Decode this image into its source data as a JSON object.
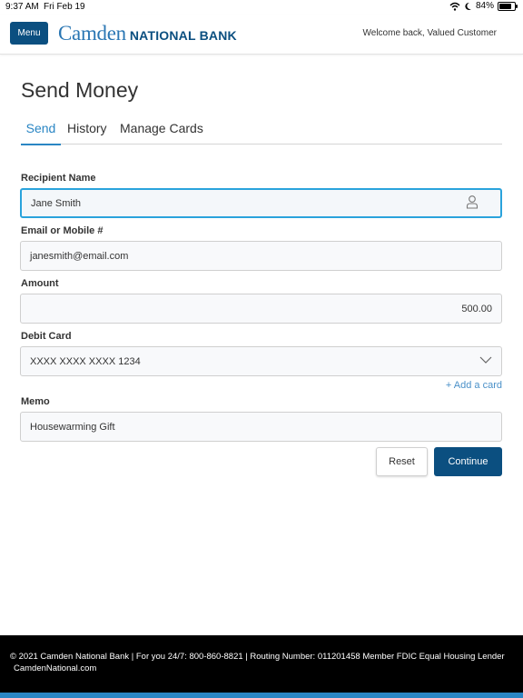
{
  "status_bar": {
    "time": "9:37 AM",
    "date": "Fri Feb 19",
    "battery": "84%",
    "battery_level": 0.84
  },
  "header": {
    "menu_label": "Menu",
    "logo_primary": "Camden",
    "logo_secondary": "NATIONAL BANK",
    "welcome": "Welcome back, Valued Customer"
  },
  "page": {
    "title": "Send Money"
  },
  "tabs": [
    {
      "label": "Send",
      "active": true
    },
    {
      "label": "History",
      "active": false
    },
    {
      "label": "Manage Cards",
      "active": false
    }
  ],
  "form": {
    "recipient": {
      "label": "Recipient Name",
      "value": "Jane Smith",
      "icon": "person-icon"
    },
    "contact": {
      "label": "Email or Mobile #",
      "value": "janesmith@email.com"
    },
    "amount": {
      "label": "Amount",
      "value": "500.00"
    },
    "debit_card": {
      "label": "Debit Card",
      "value": "XXXX XXXX XXXX 1234",
      "icon": "chevron-down-icon"
    },
    "add_card": "+ Add a card",
    "memo": {
      "label": "Memo",
      "value": "Housewarming Gift"
    },
    "reset_label": "Reset",
    "continue_label": "Continue"
  },
  "footer": {
    "line1": "© 2021 Camden National Bank | For you 24/7: 800-860-8821 | Routing Number: 011201458  Member FDIC  Equal Housing Lender",
    "line2": "CamdenNational.com"
  },
  "colors": {
    "brand": "#0b4f80",
    "accent": "#2a86c4",
    "focus": "#2aa3dc"
  }
}
